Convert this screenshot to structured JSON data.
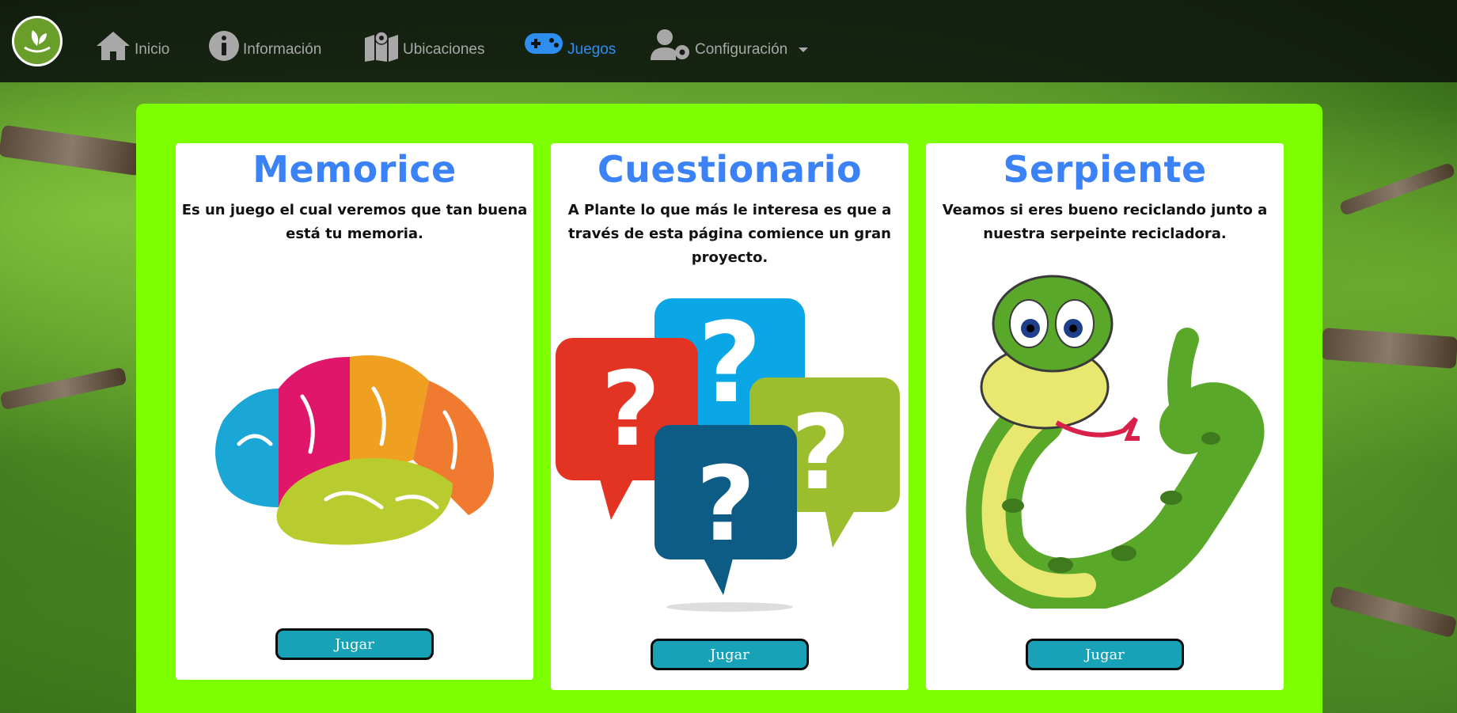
{
  "nav": {
    "items": [
      {
        "label": "Inicio",
        "icon": "home-icon"
      },
      {
        "label": "Información",
        "icon": "info-icon"
      },
      {
        "label": "Ubicaciones",
        "icon": "map-icon"
      },
      {
        "label": "Juegos",
        "icon": "gamepad-icon"
      },
      {
        "label": "Configuración",
        "icon": "user-gear-icon"
      }
    ],
    "active_color": "#2e8ef0",
    "inactive_color": "#a8a8a8"
  },
  "panel": {
    "background": "#7cff00"
  },
  "cards": [
    {
      "title": "Memorice",
      "description": "Es un juego el cual veremos que tan buena está tu memoria.",
      "button": "Jugar",
      "image": "colorful-brain-image"
    },
    {
      "title": "Cuestionario",
      "description": "A Plante lo que más le interesa es que a través de esta página comience un gran proyecto.",
      "button": "Jugar",
      "image": "question-bubbles-image"
    },
    {
      "title": "Serpiente",
      "description": "Veamos si eres bueno reciclando junto a nuestra serpeinte recicladora.",
      "button": "Jugar",
      "image": "cartoon-snake-image"
    }
  ],
  "colors": {
    "title": "#3b82f6",
    "button": "#17a2b8"
  }
}
